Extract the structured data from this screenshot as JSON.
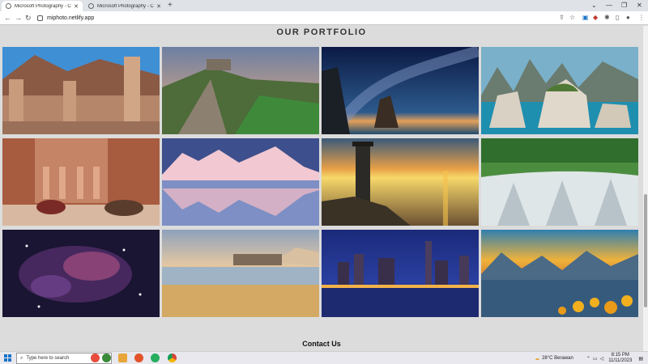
{
  "tabs": [
    {
      "title": "Microsoft Photography - Captu",
      "active": true
    },
    {
      "title": "Microsoft Photography - Captu",
      "active": false
    }
  ],
  "new_tab_label": "+",
  "url": "miphoto.netlify.app",
  "page": {
    "portfolio_title": "OUR PORTFOLIO",
    "contact_title": "Contact Us",
    "photos": [
      {
        "subject": "ancient ruins columns desert"
      },
      {
        "subject": "castle on green hill at sunset"
      },
      {
        "subject": "milky way over sea rocks"
      },
      {
        "subject": "limestone islands in turquoise sea"
      },
      {
        "subject": "petra treasury with camels"
      },
      {
        "subject": "snowy mountains reflected in lake"
      },
      {
        "subject": "lighthouse at sunset"
      },
      {
        "subject": "waterfall in green forest"
      },
      {
        "subject": "starry nebula"
      },
      {
        "subject": "sandy beach with rocks"
      },
      {
        "subject": "city skyline at night"
      },
      {
        "subject": "mountain lake with flowers at sunset"
      }
    ]
  },
  "taskbar": {
    "search_placeholder": "Type here to search",
    "weather": "28°C  Berawan",
    "time": "8:15 PM",
    "date": "11/11/2023"
  },
  "colors": {
    "accent": "#1a73c8",
    "page_bg": "#dcdcdc"
  }
}
